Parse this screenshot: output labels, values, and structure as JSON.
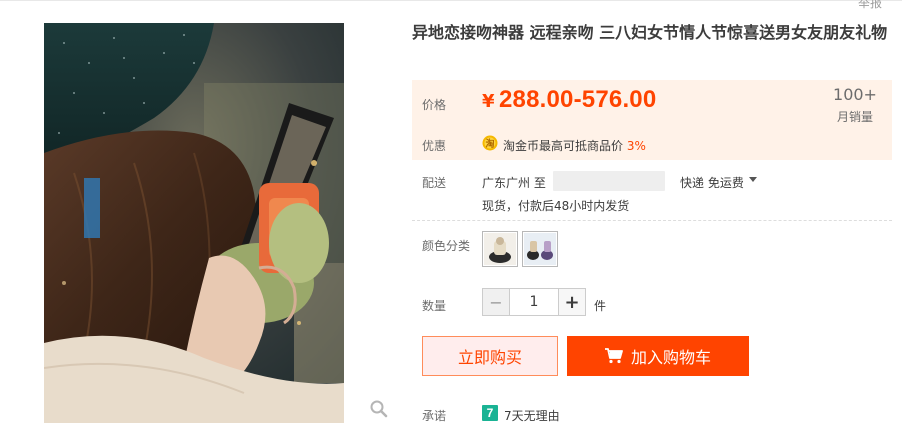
{
  "header": {
    "report_label": "举报"
  },
  "product": {
    "title": "异地恋接吻神器 远程亲吻 三八妇女节情人节惊喜送男女友朋友礼物",
    "image_icon": "zoom-magnifier-icon"
  },
  "price": {
    "label": "价格",
    "currency": "¥",
    "range": "288.00-576.00",
    "sales_count": "100+",
    "sales_label": "月销量",
    "accent_color": "#ff4400"
  },
  "promo": {
    "label": "优惠",
    "icon": "taojinbi-coin-icon",
    "text": "淘金币最高可抵商品价",
    "percent": "3%"
  },
  "shipping": {
    "label": "配送",
    "from": "广东广州 至",
    "method": "快递 免运费",
    "note": "现货，付款后48小时内发货"
  },
  "color": {
    "label": "颜色分类",
    "options": [
      "swatch-1",
      "swatch-2"
    ]
  },
  "quantity": {
    "label": "数量",
    "minus": "−",
    "value": "1",
    "plus": "+",
    "unit": "件"
  },
  "actions": {
    "buy_now": "立即购买",
    "add_to_cart": "加入购物车"
  },
  "promise": {
    "label": "承诺",
    "icon_glyph": "7",
    "text": "7天无理由"
  }
}
